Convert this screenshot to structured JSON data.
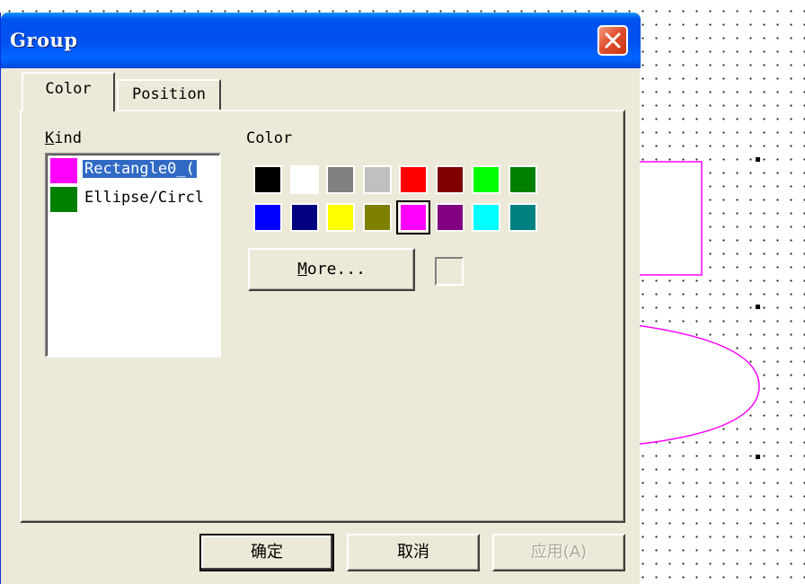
{
  "dialog": {
    "title": "Group",
    "close_icon": "close-icon"
  },
  "tabs": [
    {
      "label": "Color",
      "active": true
    },
    {
      "label": "Position",
      "active": false
    }
  ],
  "kind": {
    "label_accel": "K",
    "label_rest": "ind",
    "items": [
      {
        "text": "Rectangle0_(",
        "color": "#ff00ff",
        "selected": true
      },
      {
        "text": "Ellipse/Circl",
        "color": "#008000",
        "selected": false
      }
    ]
  },
  "color_section": {
    "label": "Color",
    "palette": [
      "#000000",
      "#ffffff",
      "#808080",
      "#c0c0c0",
      "#ff0000",
      "#800000",
      "#00ff00",
      "#008000",
      "#0000ff",
      "#000080",
      "#ffff00",
      "#808000",
      "#ff00ff",
      "#800080",
      "#00ffff",
      "#008080"
    ],
    "selected_color": "#ff00ff",
    "more_accel": "M",
    "more_rest": "ore..."
  },
  "buttons": {
    "ok": "确定",
    "cancel": "取消",
    "apply": "应用(A)"
  },
  "canvas": {
    "shape_color": "#ff00ff"
  }
}
